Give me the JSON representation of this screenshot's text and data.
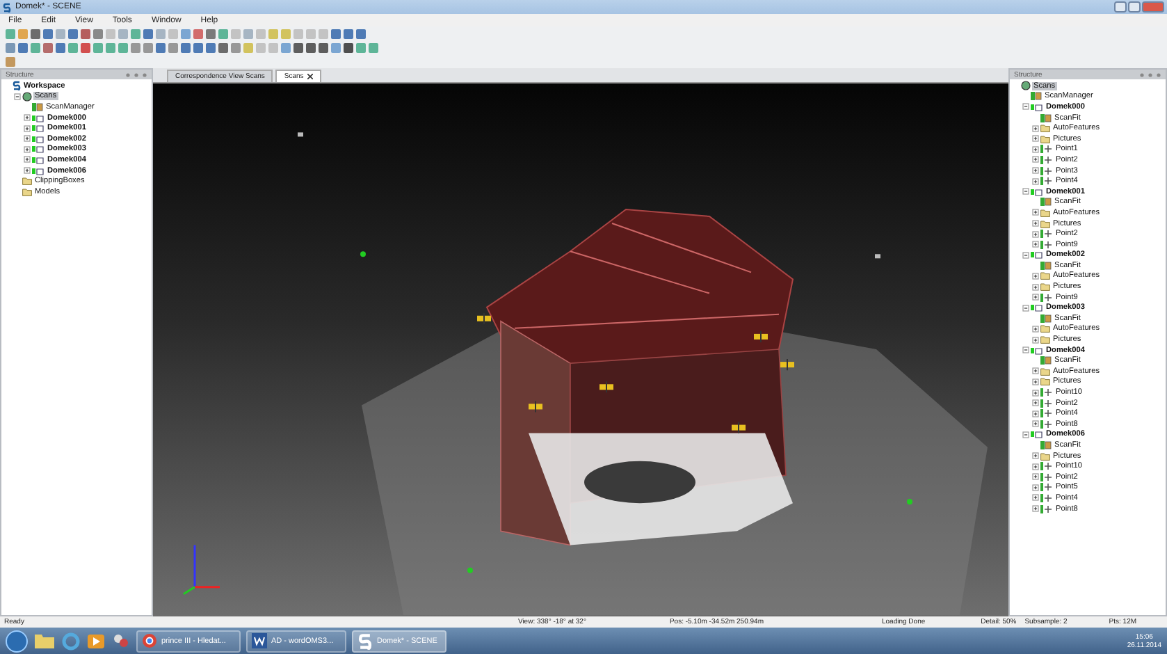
{
  "window": {
    "title": "Domek* - SCENE"
  },
  "menu": [
    "File",
    "Edit",
    "View",
    "Tools",
    "Window",
    "Help"
  ],
  "left_panel": {
    "title": "Structure",
    "tree": [
      {
        "label": "Workspace",
        "kind": "workspace",
        "selected": false,
        "children": [
          {
            "label": "Scans",
            "kind": "scans",
            "expanded": true,
            "selected": true,
            "children": [
              {
                "label": "ScanManager",
                "kind": "manager",
                "selected": false
              },
              {
                "label": "Domek000",
                "kind": "scan",
                "expanded": false,
                "selected": false
              },
              {
                "label": "Domek001",
                "kind": "scan",
                "expanded": false,
                "selected": false
              },
              {
                "label": "Domek002",
                "kind": "scan",
                "expanded": false,
                "selected": false
              },
              {
                "label": "Domek003",
                "kind": "scan",
                "expanded": false,
                "selected": false
              },
              {
                "label": "Domek004",
                "kind": "scan",
                "expanded": false,
                "selected": false
              },
              {
                "label": "Domek006",
                "kind": "scan",
                "expanded": false,
                "selected": false
              }
            ]
          },
          {
            "label": "ClippingBoxes",
            "kind": "folder",
            "selected": false
          },
          {
            "label": "Models",
            "kind": "folder",
            "selected": false
          }
        ]
      }
    ]
  },
  "tabs": [
    {
      "label": "Correspondence View Scans",
      "selected": false
    },
    {
      "label": "Scans",
      "selected": true,
      "closable": true
    }
  ],
  "right_panel": {
    "title": "Structure",
    "tree": [
      {
        "label": "Scans",
        "kind": "scans",
        "selected": true,
        "children": [
          {
            "label": "ScanManager",
            "kind": "manager",
            "selected": false
          },
          {
            "label": "Domek000",
            "kind": "scan",
            "expanded": true,
            "selected": false,
            "children": [
              {
                "label": "ScanFit",
                "kind": "manager",
                "selected": false
              },
              {
                "label": "AutoFeatures",
                "kind": "folder",
                "expanded": false,
                "selected": false
              },
              {
                "label": "Pictures",
                "kind": "folder",
                "expanded": false,
                "selected": false
              },
              {
                "label": "Point1",
                "kind": "point",
                "expanded": false,
                "selected": false
              },
              {
                "label": "Point2",
                "kind": "point",
                "expanded": false,
                "selected": false
              },
              {
                "label": "Point3",
                "kind": "point",
                "expanded": false,
                "selected": false
              },
              {
                "label": "Point4",
                "kind": "point",
                "expanded": false,
                "selected": false
              }
            ]
          },
          {
            "label": "Domek001",
            "kind": "scan",
            "expanded": true,
            "selected": false,
            "children": [
              {
                "label": "ScanFit",
                "kind": "manager",
                "selected": false
              },
              {
                "label": "AutoFeatures",
                "kind": "folder",
                "expanded": false,
                "selected": false
              },
              {
                "label": "Pictures",
                "kind": "folder",
                "expanded": false,
                "selected": false
              },
              {
                "label": "Point2",
                "kind": "point",
                "expanded": false,
                "selected": false
              },
              {
                "label": "Point9",
                "kind": "point",
                "expanded": false,
                "selected": false
              }
            ]
          },
          {
            "label": "Domek002",
            "kind": "scan",
            "expanded": true,
            "selected": false,
            "children": [
              {
                "label": "ScanFit",
                "kind": "manager",
                "selected": false
              },
              {
                "label": "AutoFeatures",
                "kind": "folder",
                "expanded": false,
                "selected": false
              },
              {
                "label": "Pictures",
                "kind": "folder",
                "expanded": false,
                "selected": false
              },
              {
                "label": "Point9",
                "kind": "point",
                "expanded": false,
                "selected": false
              }
            ]
          },
          {
            "label": "Domek003",
            "kind": "scan",
            "expanded": true,
            "selected": false,
            "children": [
              {
                "label": "ScanFit",
                "kind": "manager",
                "selected": false
              },
              {
                "label": "AutoFeatures",
                "kind": "folder",
                "expanded": false,
                "selected": false
              },
              {
                "label": "Pictures",
                "kind": "folder",
                "expanded": false,
                "selected": false
              }
            ]
          },
          {
            "label": "Domek004",
            "kind": "scan",
            "expanded": true,
            "selected": false,
            "children": [
              {
                "label": "ScanFit",
                "kind": "manager",
                "selected": false
              },
              {
                "label": "AutoFeatures",
                "kind": "folder",
                "expanded": false,
                "selected": false
              },
              {
                "label": "Pictures",
                "kind": "folder",
                "expanded": false,
                "selected": false
              },
              {
                "label": "Point10",
                "kind": "point",
                "expanded": false,
                "selected": false
              },
              {
                "label": "Point2",
                "kind": "point",
                "expanded": false,
                "selected": false
              },
              {
                "label": "Point4",
                "kind": "point",
                "expanded": false,
                "selected": false
              },
              {
                "label": "Point8",
                "kind": "point",
                "expanded": false,
                "selected": false
              }
            ]
          },
          {
            "label": "Domek006",
            "kind": "scan",
            "expanded": true,
            "selected": false,
            "children": [
              {
                "label": "ScanFit",
                "kind": "manager",
                "selected": false
              },
              {
                "label": "Pictures",
                "kind": "folder",
                "expanded": false,
                "selected": false
              },
              {
                "label": "Point10",
                "kind": "point",
                "expanded": false,
                "selected": false
              },
              {
                "label": "Point2",
                "kind": "point",
                "expanded": false,
                "selected": false
              },
              {
                "label": "Point5",
                "kind": "point",
                "expanded": false,
                "selected": false
              },
              {
                "label": "Point4",
                "kind": "point",
                "expanded": false,
                "selected": false
              },
              {
                "label": "Point8",
                "kind": "point",
                "expanded": false,
                "selected": false
              }
            ]
          }
        ]
      }
    ]
  },
  "status_bar": [
    "Ready",
    "View: 338° -18° at 32°",
    "Pos: -5.10m -34.52m 250.94m",
    "Loading Done",
    "Detail: 50%",
    "Subsample: 2",
    "Pts: 12M"
  ],
  "taskbar": {
    "buttons": [
      {
        "label": "prince III - Hledat...",
        "kind": "browser",
        "selected": false
      },
      {
        "label": "AD - wordOMS3...",
        "kind": "word",
        "selected": false
      },
      {
        "label": "Domek* - SCENE",
        "kind": "scene",
        "selected": true
      }
    ],
    "time": "15:06",
    "date": "26.11.2014"
  }
}
